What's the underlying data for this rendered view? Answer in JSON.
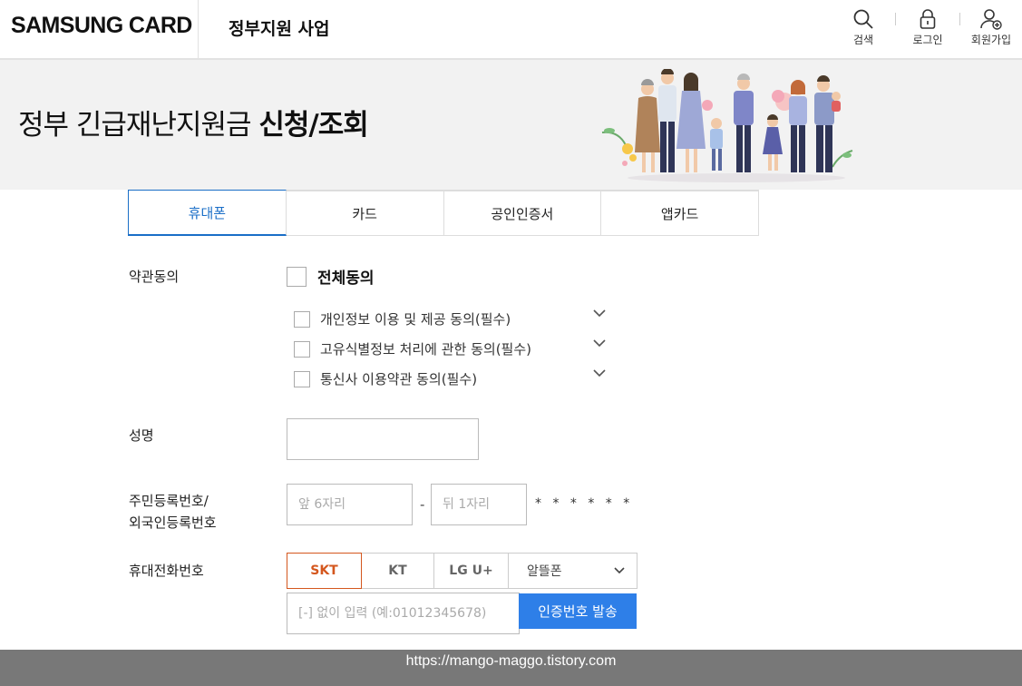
{
  "header": {
    "logo": "SAMSUNG CARD",
    "site_title": "정부지원 사업",
    "utils": [
      {
        "label": "검색",
        "icon": "search-icon"
      },
      {
        "label": "로그인",
        "icon": "lock-icon"
      },
      {
        "label": "회원가입",
        "icon": "user-add-icon"
      }
    ]
  },
  "banner": {
    "title_normal": "정부 긴급재난지원금 ",
    "title_bold": "신청/조회"
  },
  "tabs": [
    {
      "label": "휴대폰",
      "active": true
    },
    {
      "label": "카드",
      "active": false
    },
    {
      "label": "공인인증서",
      "active": false
    },
    {
      "label": "앱카드",
      "active": false
    }
  ],
  "form": {
    "terms_label": "약관동의",
    "agree_all": "전체동의",
    "terms": [
      "개인정보 이용 및 제공 동의(필수)",
      "고유식별정보 처리에 관한 동의(필수)",
      "통신사 이용약관 동의(필수)"
    ],
    "name_label": "성명",
    "name_value": "",
    "rrn_label_1": "주민등록번호/",
    "rrn_label_2": "외국인등록번호",
    "rrn_front_placeholder": "앞 6자리",
    "rrn_back_placeholder": "뒤 1자리",
    "rrn_dash": "-",
    "rrn_mask": "* * * * * *",
    "phone_label": "휴대전화번호",
    "carriers": [
      "SKT",
      "KT",
      "LG U+"
    ],
    "selected_carrier": "SKT",
    "mvno_label": "알뜰폰",
    "phone_placeholder": "[-] 없이 입력 (예:01012345678)",
    "send_button": "인증번호 발송"
  },
  "footer": {
    "watermark": "https://mango-maggo.tistory.com"
  },
  "colors": {
    "accent_blue": "#1a6ec7",
    "button_blue": "#2e7fe8",
    "carrier_active": "#d4571e",
    "banner_bg": "#f2f2f2"
  }
}
